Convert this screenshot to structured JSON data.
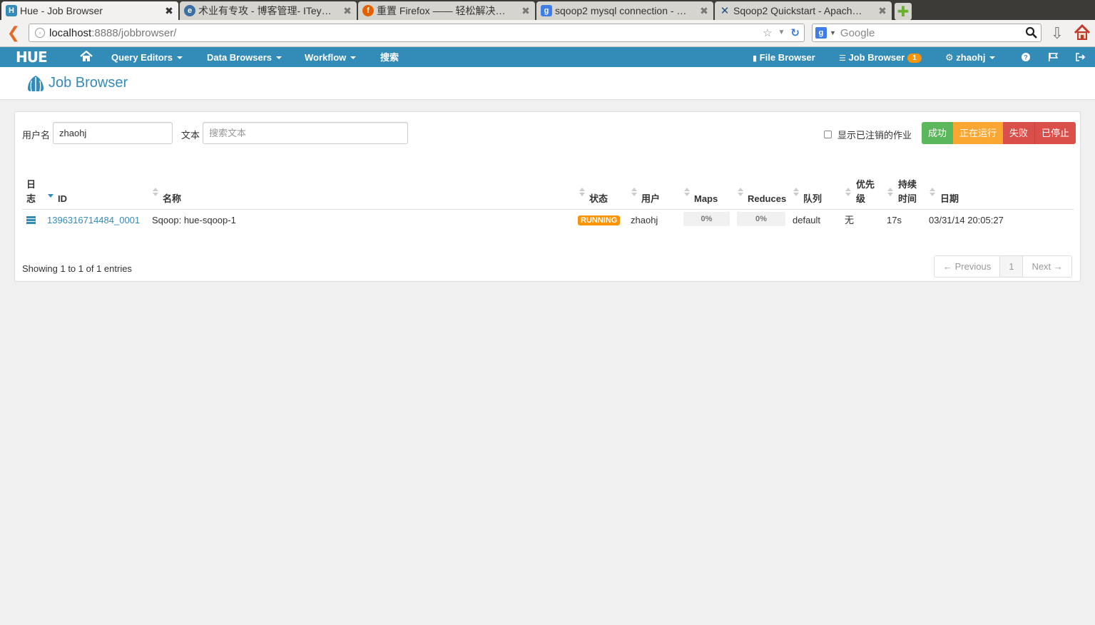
{
  "browser": {
    "tabs": [
      {
        "title": "Hue - Job Browser",
        "active": true,
        "icon": "hue-favicon"
      },
      {
        "title": "术业有专攻 - 博客管理- ITey…",
        "active": false,
        "icon": "iteye-favicon"
      },
      {
        "title": "重置 Firefox —— 轻松解决…",
        "active": false,
        "icon": "firefox-favicon"
      },
      {
        "title": "sqoop2 mysql connection - …",
        "active": false,
        "icon": "google-favicon"
      },
      {
        "title": "Sqoop2 Quickstart - Apach…",
        "active": false,
        "icon": "confluence-favicon"
      }
    ],
    "tab_close": "✖",
    "url_host": "localhost",
    "url_path": ":8888/jobbrowser/",
    "search_placeholder": "Google"
  },
  "hue_nav": {
    "logo": "HUE",
    "query_editors": "Query Editors",
    "data_browsers": "Data Browsers",
    "workflow": "Workflow",
    "search": "搜索",
    "file_browser": "File Browser",
    "job_browser": "Job Browser",
    "job_count": "1",
    "user": "zhaohj"
  },
  "page": {
    "title": "Job Browser"
  },
  "filters": {
    "username_label": "用户名",
    "username_value": "zhaohj",
    "text_label": "文本",
    "text_placeholder": "搜索文本",
    "show_killed_label": "显示已注销的作业",
    "status_buttons": [
      {
        "label": "成功",
        "color": "#5bb75b"
      },
      {
        "label": "正在运行",
        "color": "#faa732"
      },
      {
        "label": "失败",
        "color": "#da4f49"
      },
      {
        "label": "已停止",
        "color": "#da4f49"
      }
    ]
  },
  "table": {
    "headers": {
      "logs": [
        "日",
        "志"
      ],
      "id": "ID",
      "name": "名称",
      "status": "状态",
      "user": "用户",
      "maps": "Maps",
      "reduces": "Reduces",
      "queue": "队列",
      "priority": [
        "优先",
        "级"
      ],
      "duration": [
        "持续",
        "时间"
      ],
      "date": "日期"
    },
    "rows": [
      {
        "id": "1396316714484_0001",
        "name": "Sqoop: hue-sqoop-1",
        "status": "RUNNING",
        "user": "zhaohj",
        "maps": "0%",
        "maps_progress": 0,
        "reduces": "0%",
        "reduces_progress": 0,
        "queue": "default",
        "priority": "无",
        "duration": "17s",
        "date": "03/31/14 20:05:27"
      }
    ]
  },
  "footer": {
    "showing": "Showing 1 to 1 of 1 entries",
    "previous": "← Previous",
    "page": "1",
    "next": "Next →"
  }
}
